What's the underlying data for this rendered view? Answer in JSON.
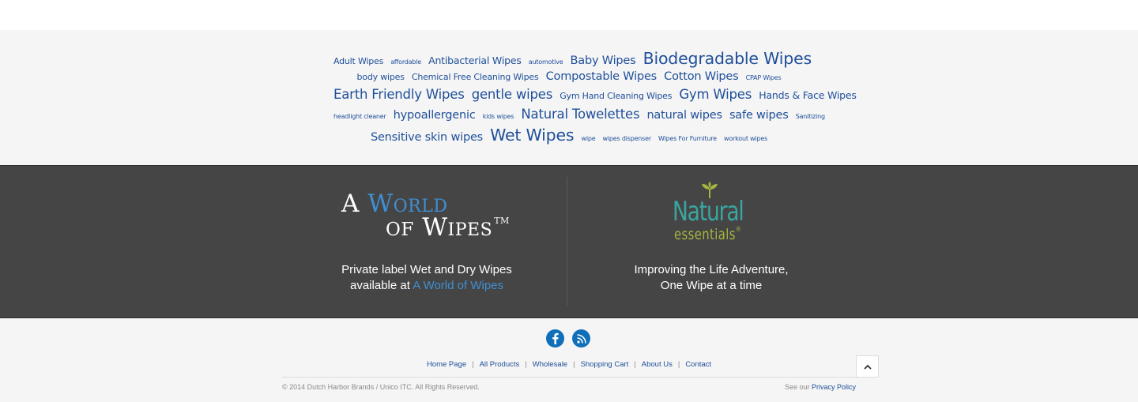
{
  "tag_cloud": {
    "lines": [
      [
        {
          "label": "Adult Wipes",
          "size": 3
        },
        {
          "label": "affordable",
          "size": 1
        },
        {
          "label": "Antibacterial Wipes",
          "size": 4
        },
        {
          "label": "automotive",
          "size": 1
        },
        {
          "label": "Baby Wipes",
          "size": 5
        },
        {
          "label": "Biodegradable Wipes",
          "size": 7
        }
      ],
      [
        {
          "label": "body wipes",
          "size": 3
        },
        {
          "label": "Chemical Free Cleaning Wipes",
          "size": 3
        },
        {
          "label": "Compostable Wipes",
          "size": 5
        },
        {
          "label": "Cotton Wipes",
          "size": 5
        },
        {
          "label": "CPAP Wipes",
          "size": 1
        }
      ],
      [
        {
          "label": "Earth Friendly Wipes",
          "size": 6
        },
        {
          "label": "gentle wipes",
          "size": 6
        },
        {
          "label": "Gym Hand Cleaning Wipes",
          "size": 3
        },
        {
          "label": "Gym Wipes",
          "size": 6
        },
        {
          "label": "Hands & Face Wipes",
          "size": 4
        }
      ],
      [
        {
          "label": "headlight cleaner",
          "size": 1
        },
        {
          "label": "hypoallergenic",
          "size": 5
        },
        {
          "label": "kids wipes",
          "size": 1
        },
        {
          "label": "Natural Towelettes",
          "size": 6
        },
        {
          "label": "natural wipes",
          "size": 5
        },
        {
          "label": "safe wipes",
          "size": 5
        },
        {
          "label": "Sanitizing",
          "size": 1
        }
      ],
      [
        {
          "label": "Sensitive skin wipes",
          "size": 5
        },
        {
          "label": "Wet Wipes",
          "size": 7
        },
        {
          "label": "wipe",
          "size": 1
        },
        {
          "label": "wipes dispenser",
          "size": 1
        },
        {
          "label": "Wipes For Furniture",
          "size": 1
        },
        {
          "label": "workout wipes",
          "size": 1
        }
      ]
    ]
  },
  "brands": {
    "left": {
      "logo_word1": "A",
      "logo_word2": "World",
      "logo_word3": "of",
      "logo_word4": "Wipes",
      "logo_tm": "TM",
      "text_line1": "Private label Wet and Dry Wipes",
      "text_line2_prefix": "available at",
      "text_link": "A World of Wipes"
    },
    "right": {
      "logo_natural": "Natural",
      "logo_essentials": "essentials",
      "logo_reg": "®",
      "text_line1": "Improving the Life Adventure,",
      "text_line2": "One Wipe at a time"
    }
  },
  "social": [
    {
      "name": "facebook-icon",
      "label": "f"
    },
    {
      "name": "rss-icon",
      "label": "rss"
    }
  ],
  "footer_nav": [
    "Home Page",
    "All Products",
    "Wholesale",
    "Shopping Cart",
    "About Us",
    "Contact"
  ],
  "footer": {
    "copyright": "© 2014 Dutch Harbor Brands / Unico ITC. All Rights Reserved.",
    "privacy_prefix": "See our",
    "privacy_link": "Privacy Policy"
  },
  "colors": {
    "link": "#1f4f9a",
    "dark_band": "#454545",
    "light_bg": "#f5f5f5",
    "accent_blue": "#3f8fd2",
    "social_blue": "#0f6fb9",
    "natural_teal": "#3aa6a1",
    "essentials_green": "#a7b440"
  }
}
